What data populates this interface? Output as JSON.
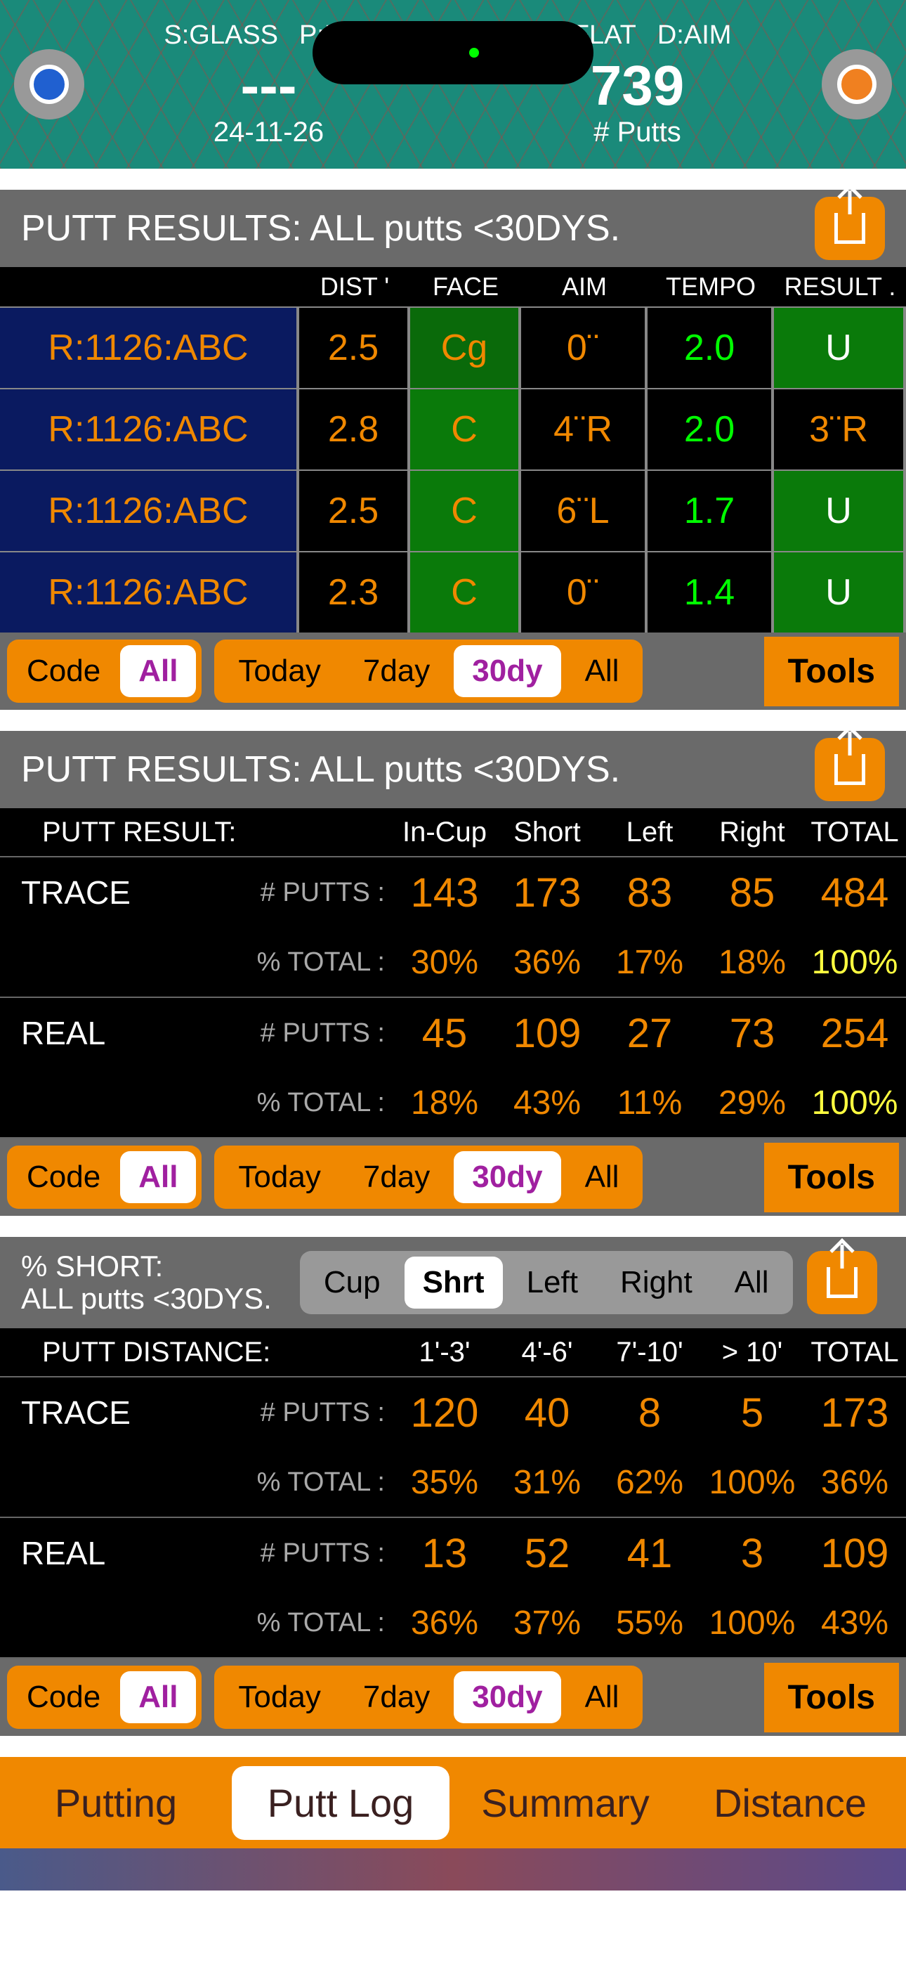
{
  "header": {
    "left_tags": [
      "S:GLASS",
      "P:MID"
    ],
    "left_big": "---",
    "left_sub": "24-11-26",
    "right_tags": [
      "M:FLAT",
      "D:AIM"
    ],
    "right_big": "739",
    "right_sub": "# Putts"
  },
  "section1": {
    "title": "PUTT RESULTS: ALL putts <30DYS.",
    "columns": [
      "DIST '",
      "FACE",
      "AIM",
      "TEMPO",
      "RESULT ."
    ],
    "rows": [
      {
        "code": "R:1126:ABC",
        "dist": "2.5",
        "face": "Cg",
        "face_cls": "cell-dgreen",
        "aim": "0¨",
        "tempo": "2.0",
        "result": "U",
        "result_cls": "cell-greenw"
      },
      {
        "code": "R:1126:ABC",
        "dist": "2.8",
        "face": "C",
        "face_cls": "cell-green",
        "aim": "4¨R",
        "tempo": "2.0",
        "result": "3¨R",
        "result_cls": "cell-black"
      },
      {
        "code": "R:1126:ABC",
        "dist": "2.5",
        "face": "C",
        "face_cls": "cell-green",
        "aim": "6¨L",
        "tempo": "1.7",
        "result": "U",
        "result_cls": "cell-greenw"
      },
      {
        "code": "R:1126:ABC",
        "dist": "2.3",
        "face": "C",
        "face_cls": "cell-green",
        "aim": "0¨",
        "tempo": "1.4",
        "result": "U",
        "result_cls": "cell-greenw"
      }
    ]
  },
  "controls": {
    "code_label": "Code",
    "code_value": "All",
    "range": [
      "Today",
      "7day",
      "30dy",
      "All"
    ],
    "range_active": "30dy",
    "tools": "Tools"
  },
  "section2": {
    "title": "PUTT RESULTS: ALL putts <30DYS.",
    "head_label": "PUTT RESULT:",
    "columns": [
      "In-Cup",
      "Short",
      "Left",
      "Right",
      "TOTAL"
    ],
    "groups": [
      {
        "name": "TRACE",
        "putts_label": "# PUTTS :",
        "putts": [
          "143",
          "173",
          "83",
          "85",
          "484"
        ],
        "pct_label": "% TOTAL :",
        "pct": [
          "30%",
          "36%",
          "17%",
          "18%",
          "100%"
        ]
      },
      {
        "name": "REAL",
        "putts_label": "# PUTTS :",
        "putts": [
          "45",
          "109",
          "27",
          "73",
          "254"
        ],
        "pct_label": "% TOTAL :",
        "pct": [
          "18%",
          "43%",
          "11%",
          "29%",
          "100%"
        ]
      }
    ]
  },
  "section3": {
    "title_line1": "% SHORT:",
    "title_line2": "ALL putts <30DYS.",
    "filter": [
      "Cup",
      "Shrt",
      "Left",
      "Right",
      "All"
    ],
    "filter_active": "Shrt",
    "head_label": "PUTT DISTANCE:",
    "columns": [
      "1'-3'",
      "4'-6'",
      "7'-10'",
      "> 10'",
      "TOTAL"
    ],
    "groups": [
      {
        "name": "TRACE",
        "putts_label": "# PUTTS :",
        "putts": [
          "120",
          "40",
          "8",
          "5",
          "173"
        ],
        "pct_label": "% TOTAL :",
        "pct": [
          "35%",
          "31%",
          "62%",
          "100%",
          "36%"
        ]
      },
      {
        "name": "REAL",
        "putts_label": "# PUTTS :",
        "putts": [
          "13",
          "52",
          "41",
          "3",
          "109"
        ],
        "pct_label": "% TOTAL :",
        "pct": [
          "36%",
          "37%",
          "55%",
          "100%",
          "43%"
        ]
      }
    ]
  },
  "tabs": {
    "items": [
      "Putting",
      "Putt Log",
      "Summary",
      "Distance"
    ],
    "active": "Putt Log"
  }
}
